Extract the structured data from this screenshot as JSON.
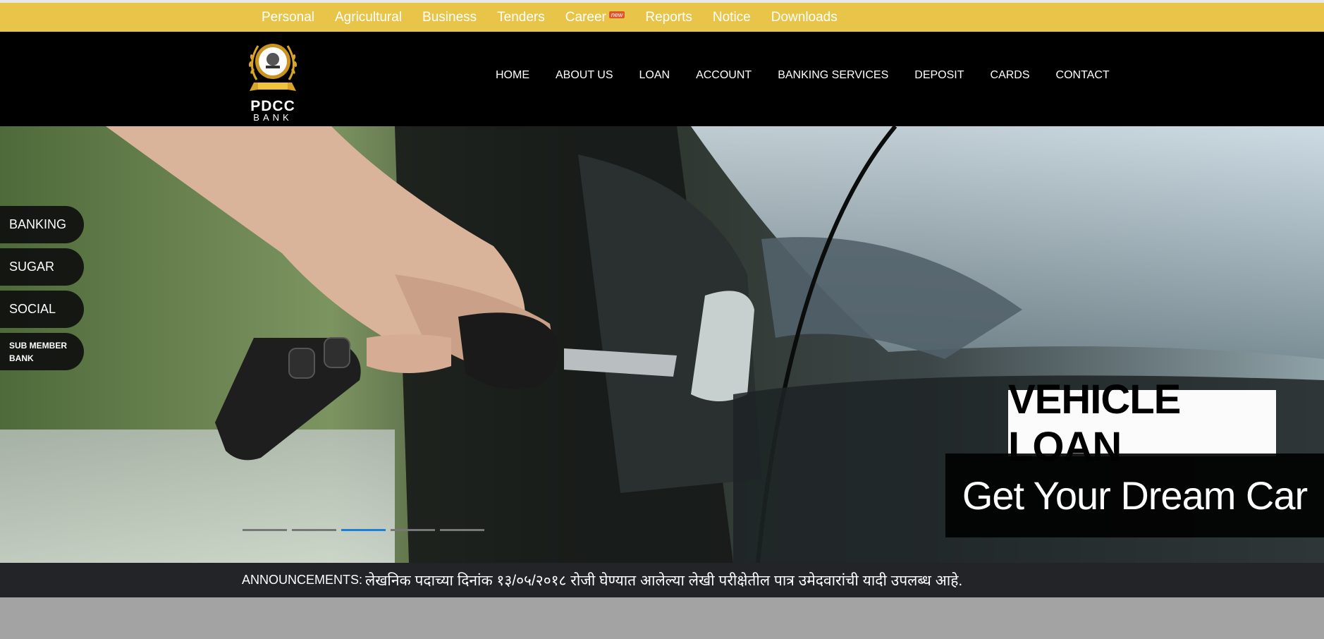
{
  "topbar": {
    "links": [
      "Personal",
      "Agricultural",
      "Business",
      "Tenders",
      "Career",
      "Reports",
      "Notice",
      "Downloads"
    ],
    "new_badge": "new"
  },
  "logo": {
    "line1": "PDCC",
    "line2": "BANK"
  },
  "nav": {
    "items": [
      "HOME",
      "ABOUT US",
      "LOAN",
      "ACCOUNT",
      "BANKING SERVICES",
      "DEPOSIT",
      "CARDS",
      "CONTACT"
    ]
  },
  "sidetabs": [
    "BANKING",
    "SUGAR",
    "SOCIAL",
    "SUB MEMBER BANK"
  ],
  "slider": {
    "caption_title": "VEHICLE LOAN",
    "caption_subtitle": "Get Your Dream Car",
    "slide_count": 5,
    "active_slide": 3
  },
  "announcement": {
    "label": "ANNOUNCEMENTS:",
    "text": "लेखनिक पदाच्या दिनांक १३/०५/२०१८ रोजी घेण्यात आलेल्या लेखी परीक्षेतील पात्र उमेदवारांची यादी उपलब्ध आहे."
  },
  "colors": {
    "topbar": "#e8c548",
    "header": "#000000",
    "active_dot": "#1e7fd9",
    "announcement_bar": "#222428"
  }
}
